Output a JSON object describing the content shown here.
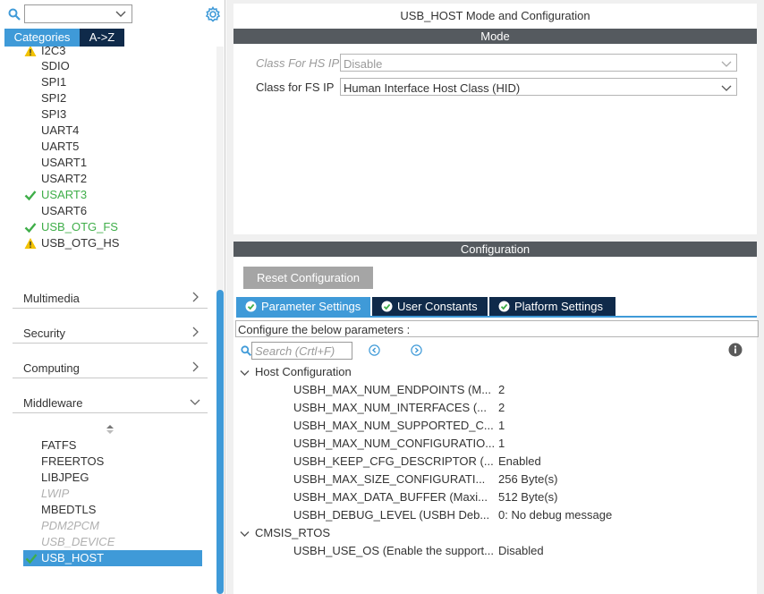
{
  "left": {
    "tabs": {
      "categories": "Categories",
      "az": "A->Z"
    },
    "connectivity_items": [
      {
        "label": "I2C3",
        "status": "warning"
      },
      {
        "label": "SDIO",
        "status": "none"
      },
      {
        "label": "SPI1",
        "status": "none"
      },
      {
        "label": "SPI2",
        "status": "none"
      },
      {
        "label": "SPI3",
        "status": "none"
      },
      {
        "label": "UART4",
        "status": "none"
      },
      {
        "label": "UART5",
        "status": "none"
      },
      {
        "label": "USART1",
        "status": "none"
      },
      {
        "label": "USART2",
        "status": "none"
      },
      {
        "label": "USART3",
        "status": "ok"
      },
      {
        "label": "USART6",
        "status": "none"
      },
      {
        "label": "USB_OTG_FS",
        "status": "ok"
      },
      {
        "label": "USB_OTG_HS",
        "status": "warning"
      }
    ],
    "groups": [
      {
        "label": "Multimedia",
        "expanded": false
      },
      {
        "label": "Security",
        "expanded": false
      },
      {
        "label": "Computing",
        "expanded": false
      },
      {
        "label": "Middleware",
        "expanded": true
      }
    ],
    "middleware_items": [
      {
        "label": "FATFS",
        "status": "none"
      },
      {
        "label": "FREERTOS",
        "status": "none"
      },
      {
        "label": "LIBJPEG",
        "status": "none"
      },
      {
        "label": "LWIP",
        "status": "disabled"
      },
      {
        "label": "MBEDTLS",
        "status": "none"
      },
      {
        "label": "PDM2PCM",
        "status": "disabled"
      },
      {
        "label": "USB_DEVICE",
        "status": "disabled"
      },
      {
        "label": "USB_HOST",
        "status": "ok",
        "selected": true
      }
    ]
  },
  "right": {
    "title": "USB_HOST Mode and Configuration",
    "mode_label": "Mode",
    "mode_fields": [
      {
        "label": "Class For HS IP",
        "value": "Disable",
        "enabled": false
      },
      {
        "label": "Class for FS IP",
        "value": "Human Interface Host Class (HID)",
        "enabled": true
      }
    ],
    "config_label": "Configuration",
    "reset_label": "Reset Configuration",
    "tabs": [
      "Parameter Settings",
      "User Constants",
      "Platform Settings"
    ],
    "hint": "Configure the below parameters :",
    "search_placeholder": "Search (Crtl+F)",
    "sections": [
      {
        "name": "Host Configuration",
        "params": [
          {
            "name": "USBH_MAX_NUM_ENDPOINTS (M...",
            "value": "2"
          },
          {
            "name": "USBH_MAX_NUM_INTERFACES (...",
            "value": "2"
          },
          {
            "name": "USBH_MAX_NUM_SUPPORTED_C...",
            "value": "1"
          },
          {
            "name": "USBH_MAX_NUM_CONFIGURATIO...",
            "value": "1"
          },
          {
            "name": "USBH_KEEP_CFG_DESCRIPTOR (...",
            "value": "Enabled"
          },
          {
            "name": "USBH_MAX_SIZE_CONFIGURATI...",
            "value": "256 Byte(s)"
          },
          {
            "name": "USBH_MAX_DATA_BUFFER (Maxi...",
            "value": "512 Byte(s)"
          },
          {
            "name": "USBH_DEBUG_LEVEL (USBH Deb...",
            "value": "0: No debug message"
          }
        ]
      },
      {
        "name": "CMSIS_RTOS",
        "params": [
          {
            "name": "USBH_USE_OS (Enable the support...",
            "value": "Disabled"
          }
        ]
      }
    ]
  },
  "colors": {
    "accent": "#3f9ad8",
    "dark_tab": "#0f2a4a",
    "band": "#555a5f",
    "ok": "#3fae49",
    "warning": "#f2c200"
  }
}
